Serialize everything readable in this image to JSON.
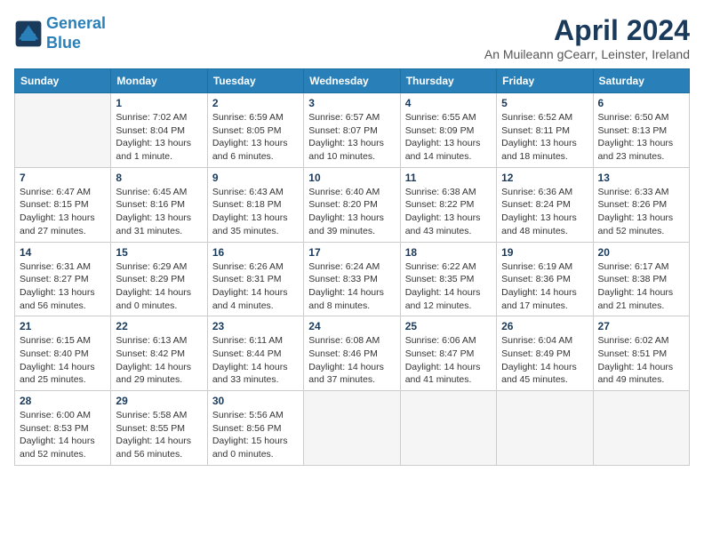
{
  "header": {
    "logo_line1": "General",
    "logo_line2": "Blue",
    "month": "April 2024",
    "location": "An Muileann gCearr, Leinster, Ireland"
  },
  "weekdays": [
    "Sunday",
    "Monday",
    "Tuesday",
    "Wednesday",
    "Thursday",
    "Friday",
    "Saturday"
  ],
  "weeks": [
    [
      {
        "day": "",
        "info": ""
      },
      {
        "day": "1",
        "info": "Sunrise: 7:02 AM\nSunset: 8:04 PM\nDaylight: 13 hours and 1 minute."
      },
      {
        "day": "2",
        "info": "Sunrise: 6:59 AM\nSunset: 8:05 PM\nDaylight: 13 hours and 6 minutes."
      },
      {
        "day": "3",
        "info": "Sunrise: 6:57 AM\nSunset: 8:07 PM\nDaylight: 13 hours and 10 minutes."
      },
      {
        "day": "4",
        "info": "Sunrise: 6:55 AM\nSunset: 8:09 PM\nDaylight: 13 hours and 14 minutes."
      },
      {
        "day": "5",
        "info": "Sunrise: 6:52 AM\nSunset: 8:11 PM\nDaylight: 13 hours and 18 minutes."
      },
      {
        "day": "6",
        "info": "Sunrise: 6:50 AM\nSunset: 8:13 PM\nDaylight: 13 hours and 23 minutes."
      }
    ],
    [
      {
        "day": "7",
        "info": "Sunrise: 6:47 AM\nSunset: 8:15 PM\nDaylight: 13 hours and 27 minutes."
      },
      {
        "day": "8",
        "info": "Sunrise: 6:45 AM\nSunset: 8:16 PM\nDaylight: 13 hours and 31 minutes."
      },
      {
        "day": "9",
        "info": "Sunrise: 6:43 AM\nSunset: 8:18 PM\nDaylight: 13 hours and 35 minutes."
      },
      {
        "day": "10",
        "info": "Sunrise: 6:40 AM\nSunset: 8:20 PM\nDaylight: 13 hours and 39 minutes."
      },
      {
        "day": "11",
        "info": "Sunrise: 6:38 AM\nSunset: 8:22 PM\nDaylight: 13 hours and 43 minutes."
      },
      {
        "day": "12",
        "info": "Sunrise: 6:36 AM\nSunset: 8:24 PM\nDaylight: 13 hours and 48 minutes."
      },
      {
        "day": "13",
        "info": "Sunrise: 6:33 AM\nSunset: 8:26 PM\nDaylight: 13 hours and 52 minutes."
      }
    ],
    [
      {
        "day": "14",
        "info": "Sunrise: 6:31 AM\nSunset: 8:27 PM\nDaylight: 13 hours and 56 minutes."
      },
      {
        "day": "15",
        "info": "Sunrise: 6:29 AM\nSunset: 8:29 PM\nDaylight: 14 hours and 0 minutes."
      },
      {
        "day": "16",
        "info": "Sunrise: 6:26 AM\nSunset: 8:31 PM\nDaylight: 14 hours and 4 minutes."
      },
      {
        "day": "17",
        "info": "Sunrise: 6:24 AM\nSunset: 8:33 PM\nDaylight: 14 hours and 8 minutes."
      },
      {
        "day": "18",
        "info": "Sunrise: 6:22 AM\nSunset: 8:35 PM\nDaylight: 14 hours and 12 minutes."
      },
      {
        "day": "19",
        "info": "Sunrise: 6:19 AM\nSunset: 8:36 PM\nDaylight: 14 hours and 17 minutes."
      },
      {
        "day": "20",
        "info": "Sunrise: 6:17 AM\nSunset: 8:38 PM\nDaylight: 14 hours and 21 minutes."
      }
    ],
    [
      {
        "day": "21",
        "info": "Sunrise: 6:15 AM\nSunset: 8:40 PM\nDaylight: 14 hours and 25 minutes."
      },
      {
        "day": "22",
        "info": "Sunrise: 6:13 AM\nSunset: 8:42 PM\nDaylight: 14 hours and 29 minutes."
      },
      {
        "day": "23",
        "info": "Sunrise: 6:11 AM\nSunset: 8:44 PM\nDaylight: 14 hours and 33 minutes."
      },
      {
        "day": "24",
        "info": "Sunrise: 6:08 AM\nSunset: 8:46 PM\nDaylight: 14 hours and 37 minutes."
      },
      {
        "day": "25",
        "info": "Sunrise: 6:06 AM\nSunset: 8:47 PM\nDaylight: 14 hours and 41 minutes."
      },
      {
        "day": "26",
        "info": "Sunrise: 6:04 AM\nSunset: 8:49 PM\nDaylight: 14 hours and 45 minutes."
      },
      {
        "day": "27",
        "info": "Sunrise: 6:02 AM\nSunset: 8:51 PM\nDaylight: 14 hours and 49 minutes."
      }
    ],
    [
      {
        "day": "28",
        "info": "Sunrise: 6:00 AM\nSunset: 8:53 PM\nDaylight: 14 hours and 52 minutes."
      },
      {
        "day": "29",
        "info": "Sunrise: 5:58 AM\nSunset: 8:55 PM\nDaylight: 14 hours and 56 minutes."
      },
      {
        "day": "30",
        "info": "Sunrise: 5:56 AM\nSunset: 8:56 PM\nDaylight: 15 hours and 0 minutes."
      },
      {
        "day": "",
        "info": ""
      },
      {
        "day": "",
        "info": ""
      },
      {
        "day": "",
        "info": ""
      },
      {
        "day": "",
        "info": ""
      }
    ]
  ]
}
